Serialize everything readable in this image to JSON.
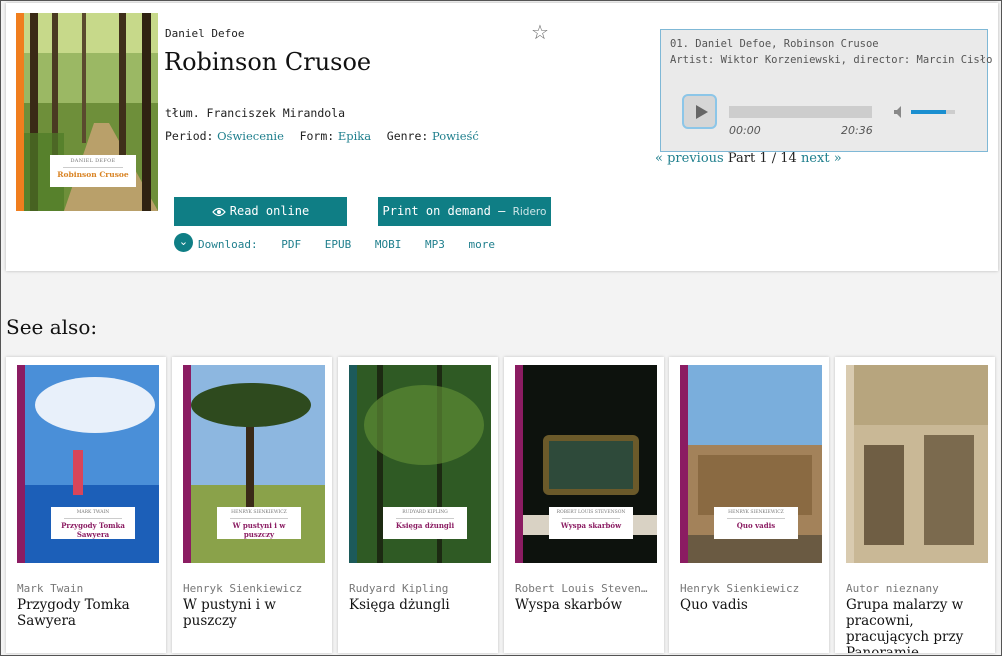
{
  "book": {
    "author": "Daniel Defoe",
    "title": "Robinson Crusoe",
    "translator": "tłum. Franciszek Mirandola",
    "cover": {
      "author": "DANIEL DEFOE",
      "title": "Robinson Crusoe",
      "spine_color": "#f07e1e",
      "title_color": "#d98323"
    },
    "period_label": "Period:",
    "period": "Oświecenie",
    "form_label": "Form:",
    "form": "Epika",
    "genre_label": "Genre:",
    "genre": "Powieść"
  },
  "actions": {
    "read_online": "Read online",
    "print_on_demand": "Print on demand –",
    "print_partner": "Ridero",
    "download_label": "Download:",
    "downloads": [
      "PDF",
      "EPUB",
      "MOBI",
      "MP3",
      "more"
    ]
  },
  "player": {
    "track": "01. Daniel Defoe, Robinson Crusoe",
    "artist": "Artist: Wiktor Korzeniewski, director: Marcin Cisło",
    "current_time": "00:00",
    "total_time": "20:36",
    "progress": 0,
    "volume": 0.8
  },
  "pager": {
    "previous": "« previous",
    "part": "Part 1 / 14",
    "next": "next »"
  },
  "see_also": {
    "heading": "See also:",
    "items": [
      {
        "author": "Mark Twain",
        "title": "Przygody Tomka Sawyera",
        "cover_author": "MARK TWAIN",
        "cover_title": "Przygody Tomka Sawyera",
        "spine": "#8b1c62"
      },
      {
        "author": "Henryk Sienkiewicz",
        "title": "W pustyni i w puszczy",
        "cover_author": "HENRYK SIENKIEWICZ",
        "cover_title": "W pustyni i w puszczy",
        "spine": "#8b1c62"
      },
      {
        "author": "Rudyard Kipling",
        "title": "Księga dżungli",
        "cover_author": "RUDYARD KIPLING",
        "cover_title": "Księga dżungli",
        "spine": "#1c5a5a"
      },
      {
        "author": "Robert Louis Steven…",
        "title": "Wyspa skarbów",
        "cover_author": "ROBERT LOUIS STEVENSON",
        "cover_title": "Wyspa skarbów",
        "spine": "#8b1c62"
      },
      {
        "author": "Henryk Sienkiewicz",
        "title": "Quo vadis",
        "cover_author": "HENRYK SIENKIEWICZ",
        "cover_title": "Quo vadis",
        "spine": "#8b1c62"
      },
      {
        "author": "Autor nieznany",
        "title": "Grupa malarzy w pracowni, pracujących przy Panoramie",
        "cover_author": "",
        "cover_title": "",
        "spine": "#d9cbb0"
      }
    ]
  }
}
